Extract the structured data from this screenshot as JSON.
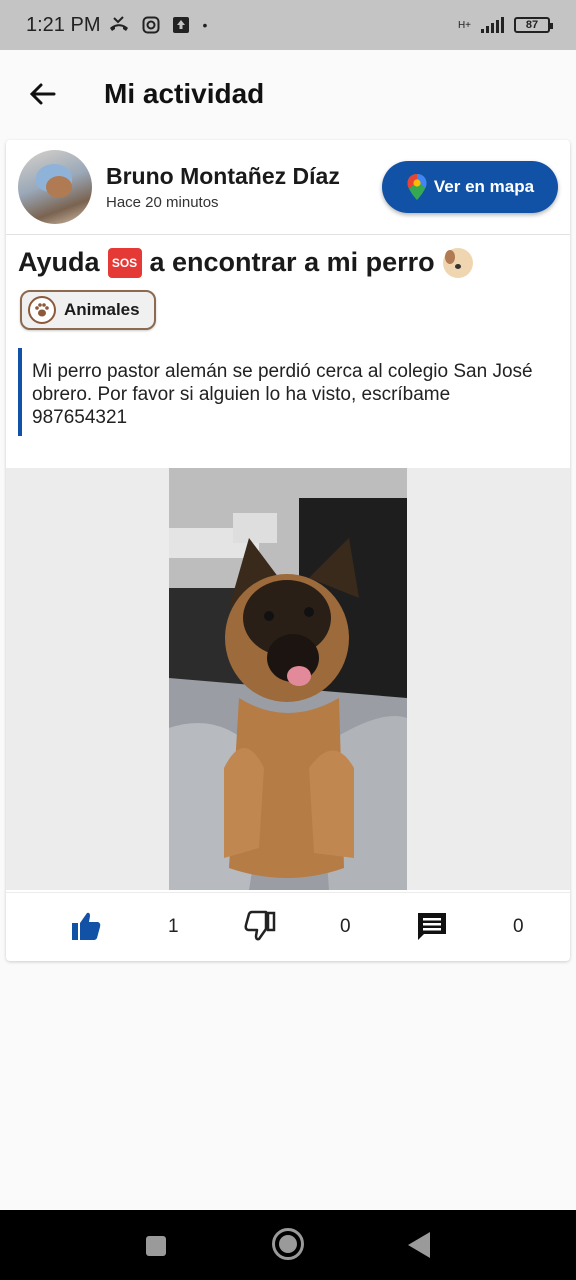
{
  "status": {
    "time": "1:21 PM",
    "network": "H+",
    "battery": "87"
  },
  "header": {
    "title": "Mi actividad",
    "back_icon": "arrow-left-icon"
  },
  "post": {
    "author": "Bruno Montañez Díaz",
    "time_ago": "Hace 20 minutos",
    "map_button": "Ver en mapa",
    "title_part1": "Ayuda",
    "sos_label": "SOS",
    "title_part2": "a encontrar a mi perro",
    "tag": "Animales",
    "description": "Mi perro pastor alemán se perdió cerca al colegio San José obrero. Por favor si alguien lo ha visto, escríbame 987654321",
    "likes": "1",
    "dislikes": "0",
    "comments": "0"
  },
  "colors": {
    "accent": "#1152a6",
    "tag_border": "#8b6a50"
  }
}
